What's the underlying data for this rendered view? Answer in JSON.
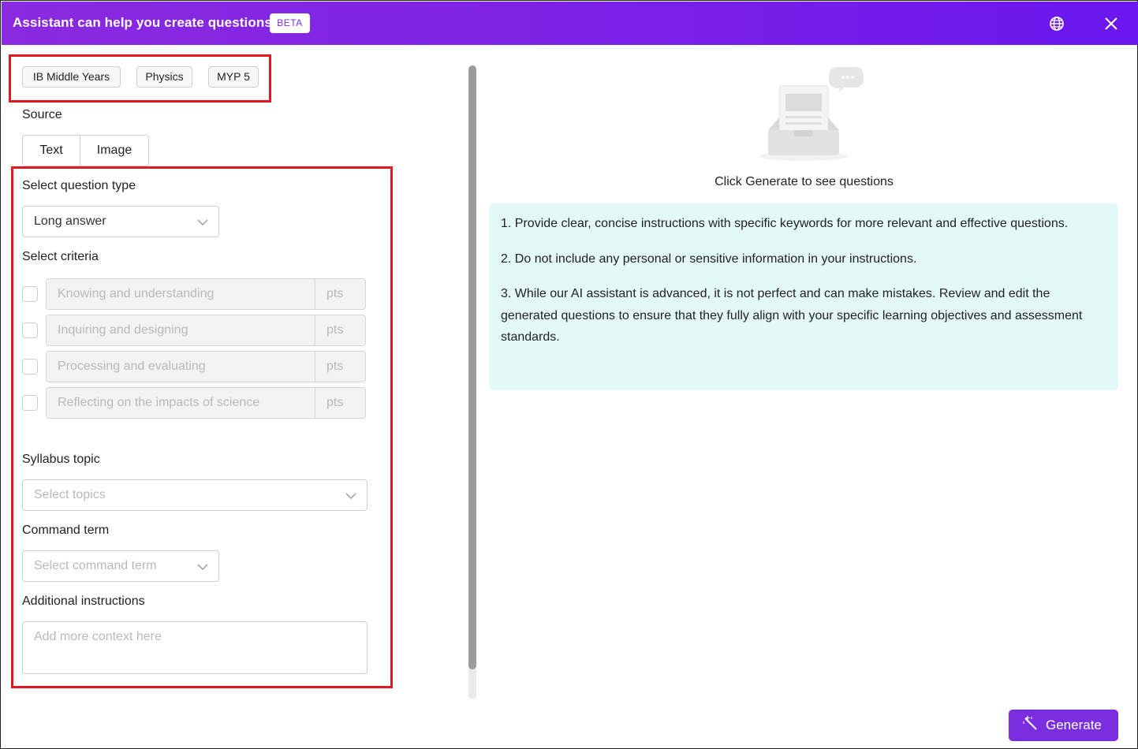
{
  "header": {
    "title": "Assistant can help you create questions",
    "badge": "BETA",
    "globe_icon": "globe-icon",
    "close_icon": "close-icon",
    "gradient": [
      "#8b2be0",
      "#6a16ee"
    ]
  },
  "tags": [
    "IB Middle Years",
    "Physics",
    "MYP 5"
  ],
  "source": {
    "label": "Source",
    "options": [
      "Text",
      "Image"
    ]
  },
  "question_type": {
    "label": "Select question type",
    "value": "Long answer"
  },
  "criteria": {
    "label": "Select criteria",
    "items": [
      {
        "name": "Knowing and understanding",
        "points_placeholder": "pts",
        "checked": false
      },
      {
        "name": "Inquiring and designing",
        "points_placeholder": "pts",
        "checked": false
      },
      {
        "name": "Processing and evaluating",
        "points_placeholder": "pts",
        "checked": false
      },
      {
        "name": "Reflecting on the impacts of science",
        "points_placeholder": "pts",
        "checked": false
      }
    ]
  },
  "syllabus_topic": {
    "label": "Syllabus topic",
    "placeholder": "Select topics"
  },
  "command_term": {
    "label": "Command term",
    "placeholder": "Select command term"
  },
  "additional_instructions": {
    "label": "Additional instructions",
    "placeholder": "Add more context here"
  },
  "empty_state": {
    "caption": "Click Generate to see questions",
    "icon": "empty-inbox-illustration"
  },
  "tips": [
    "1. Provide clear, concise instructions with specific keywords for more relevant and effective questions.",
    "2. Do not include any personal or sensitive information in your instructions.",
    "3. While our AI assistant is advanced, it is not perfect and can make mistakes. Review and edit the generated questions to ensure that they fully align with your specific learning objectives and assessment standards."
  ],
  "generate_button": {
    "label": "Generate",
    "icon": "magic-wand-icon",
    "color": "#7b2ee0"
  },
  "colors": {
    "highlight": "#e0191f",
    "tips_background": "#e3f8f9"
  }
}
